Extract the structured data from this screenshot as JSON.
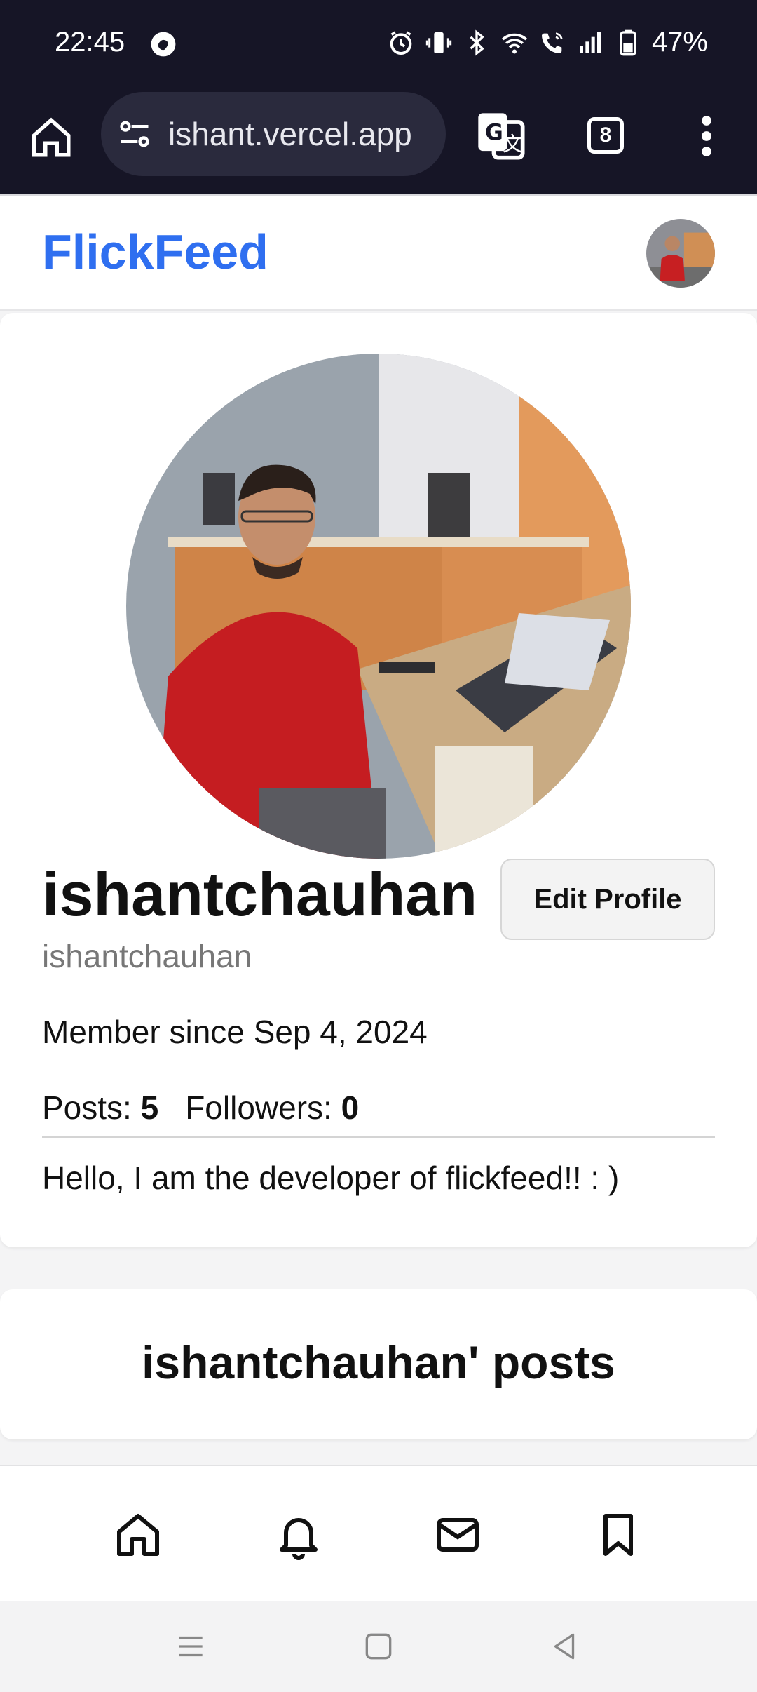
{
  "status_bar": {
    "time": "22:45",
    "battery": "47%"
  },
  "browser": {
    "url": "ishant.vercel.app",
    "tab_count": "8"
  },
  "site": {
    "brand": "FlickFeed",
    "brand_color": "#2f6ff0"
  },
  "profile": {
    "display_name": "ishantchauhan",
    "username": "ishantchauhan",
    "edit_button": "Edit Profile",
    "member_since": "Member since Sep 4, 2024",
    "posts_label": "Posts:",
    "posts_count": "5",
    "followers_label": "Followers:",
    "followers_count": "0",
    "bio": "Hello, I am the developer of flickfeed!! : )"
  },
  "posts_section": {
    "title": "ishantchauhan' posts"
  },
  "bottom_nav": {
    "items": [
      "home-icon",
      "bell-icon",
      "mail-icon",
      "bookmark-icon"
    ]
  }
}
